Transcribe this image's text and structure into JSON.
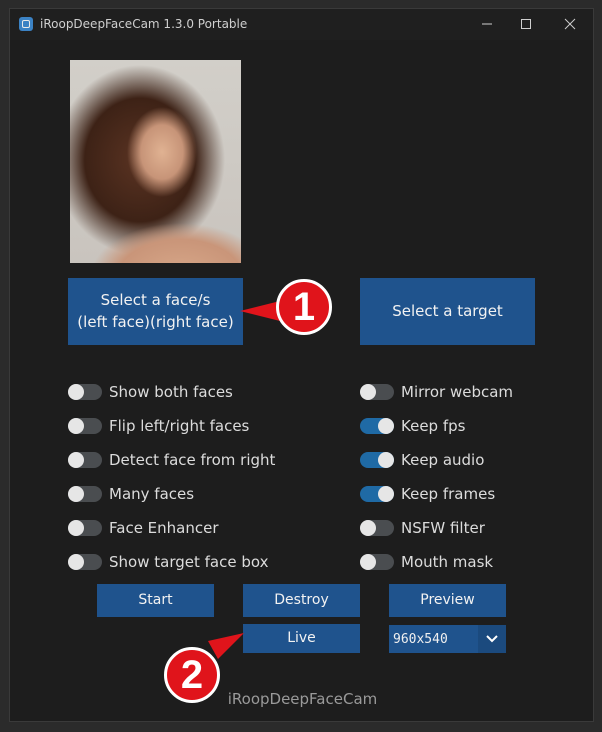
{
  "window": {
    "title": "iRoopDeepFaceCam 1.3.0 Portable",
    "icons": {
      "app": "app-icon",
      "minimize": "minimize-icon",
      "maximize": "maximize-icon",
      "close": "close-icon"
    }
  },
  "buttons": {
    "select_face_line1": "Select a face/s",
    "select_face_line2": "(left face)(right face)",
    "select_target": "Select a target",
    "start": "Start",
    "destroy": "Destroy",
    "preview": "Preview",
    "live": "Live"
  },
  "toggles_left": [
    {
      "label": "Show both faces",
      "on": false
    },
    {
      "label": "Flip left/right faces",
      "on": false
    },
    {
      "label": "Detect face from right",
      "on": false
    },
    {
      "label": "Many faces",
      "on": false
    },
    {
      "label": "Face Enhancer",
      "on": false
    },
    {
      "label": "Show target face box",
      "on": false
    }
  ],
  "toggles_right": [
    {
      "label": "Mirror webcam",
      "on": false
    },
    {
      "label": "Keep fps",
      "on": true
    },
    {
      "label": "Keep audio",
      "on": true
    },
    {
      "label": "Keep frames",
      "on": true
    },
    {
      "label": "NSFW filter",
      "on": false
    },
    {
      "label": "Mouth mask",
      "on": false
    }
  ],
  "resolution": {
    "value": "960x540",
    "icon": "chevron-down-icon"
  },
  "footer": "iRoopDeepFaceCam",
  "annotations": {
    "badge1": "1",
    "badge2": "2",
    "color": "#e0141b"
  },
  "colors": {
    "button": "#1f538d",
    "switch_on": "#1f6aa5",
    "switch_off": "#4a4d50",
    "background": "#1d1d1d"
  }
}
